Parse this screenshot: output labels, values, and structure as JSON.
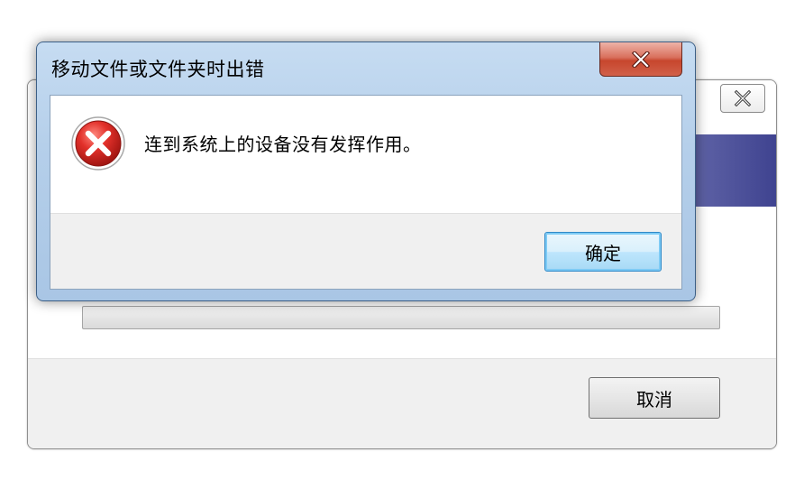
{
  "background_dialog": {
    "close_icon": "close-x-icon",
    "cancel_label": "取消"
  },
  "error_dialog": {
    "title": "移动文件或文件夹时出错",
    "close_icon": "close-x-icon",
    "icon": "error-icon",
    "message": "连到系统上的设备没有发挥作用。",
    "ok_label": "确定"
  },
  "colors": {
    "error_red": "#d92d27",
    "close_button_red": "#c7462d",
    "title_bar_blue": "#b5cfea",
    "ok_focus_blue": "#2f88c7"
  }
}
